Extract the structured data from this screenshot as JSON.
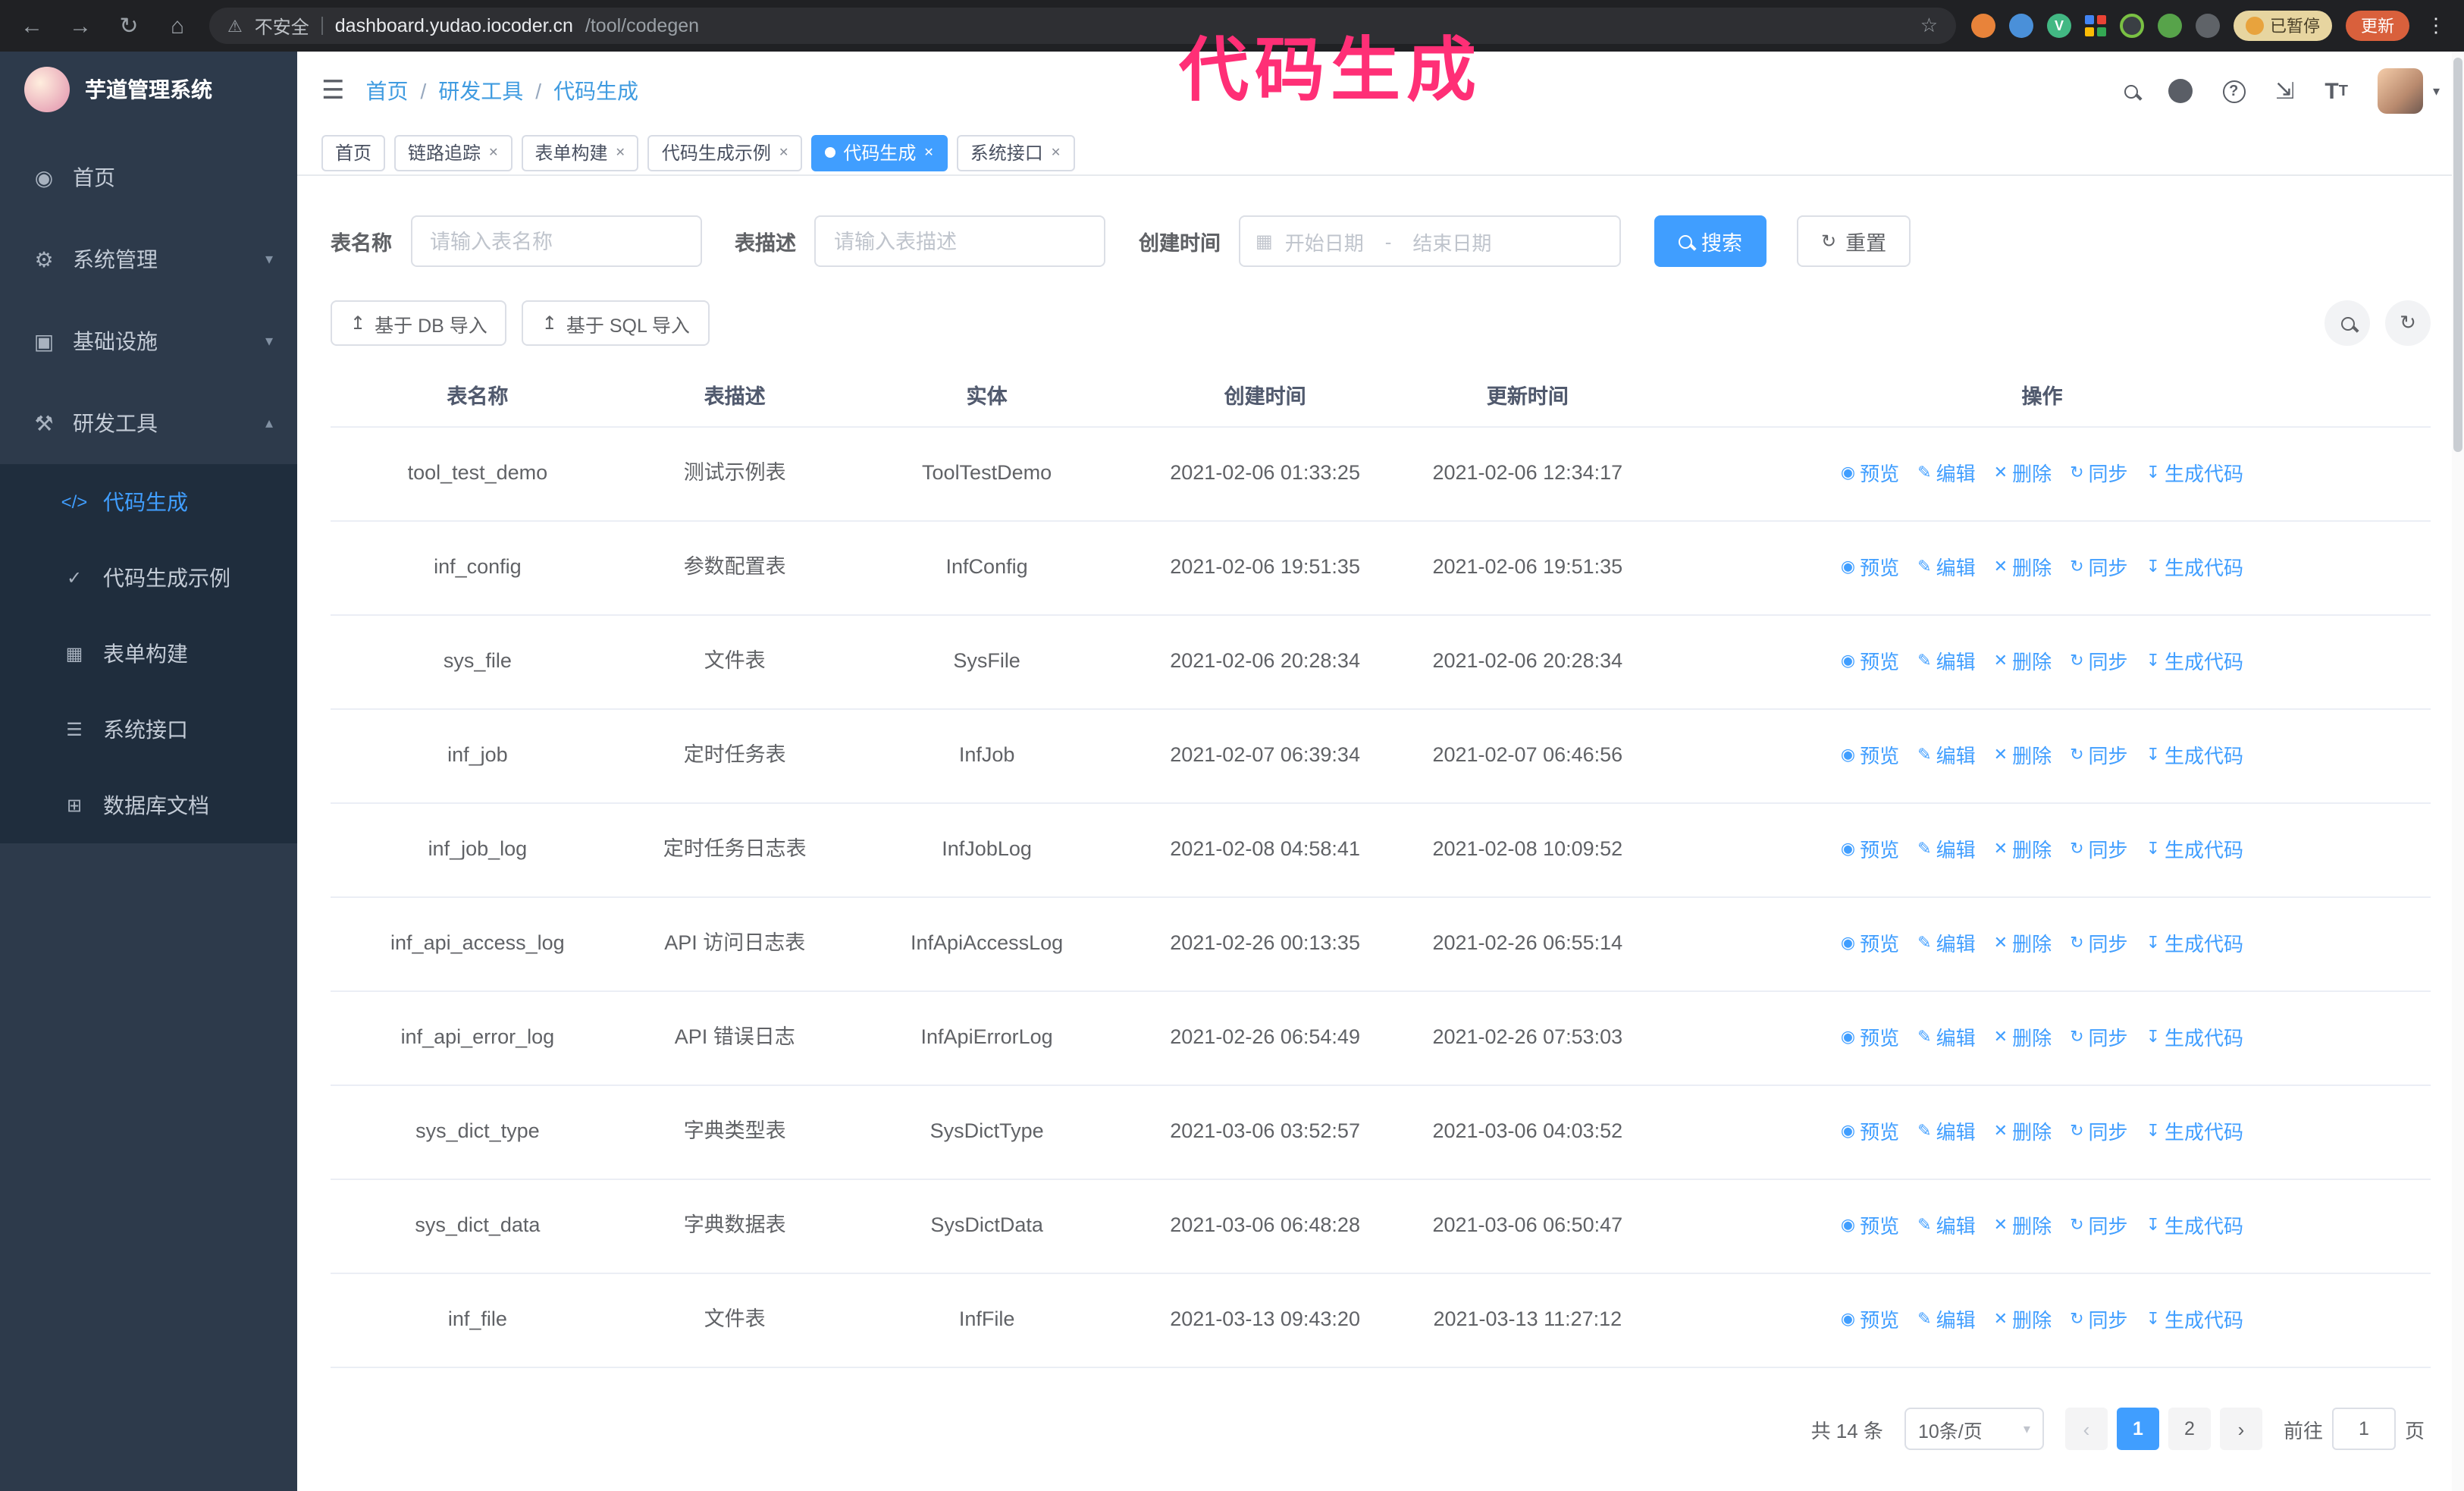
{
  "annotation": {
    "text": "代码生成",
    "color": "#ff2f76"
  },
  "browser": {
    "security_label": "不安全",
    "url_host": "dashboard.yudao.iocoder.cn",
    "url_path": "/tool/codegen",
    "paused_badge": "已暂停",
    "update_button": "更新"
  },
  "sidebar": {
    "app_title": "芋道管理系统",
    "items": [
      {
        "label": "首页"
      },
      {
        "label": "系统管理"
      },
      {
        "label": "基础设施"
      },
      {
        "label": "研发工具"
      }
    ],
    "subitems": [
      {
        "label": "代码生成",
        "active": true
      },
      {
        "label": "代码生成示例"
      },
      {
        "label": "表单构建"
      },
      {
        "label": "系统接口"
      },
      {
        "label": "数据库文档"
      }
    ]
  },
  "navbar": {
    "breadcrumb": [
      "首页",
      "研发工具",
      "代码生成"
    ]
  },
  "tabs": [
    {
      "label": "首页"
    },
    {
      "label": "链路追踪"
    },
    {
      "label": "表单构建"
    },
    {
      "label": "代码生成示例"
    },
    {
      "label": "代码生成",
      "active": true
    },
    {
      "label": "系统接口"
    }
  ],
  "filters": {
    "table_name_label": "表名称",
    "table_name_placeholder": "请输入表名称",
    "table_desc_label": "表描述",
    "table_desc_placeholder": "请输入表描述",
    "create_time_label": "创建时间",
    "date_start_placeholder": "开始日期",
    "date_separator": "-",
    "date_end_placeholder": "结束日期",
    "search_button": "搜索",
    "reset_button": "重置"
  },
  "toolbar": {
    "import_db_button": "基于 DB 导入",
    "import_sql_button": "基于 SQL 导入"
  },
  "table": {
    "columns": [
      "表名称",
      "表描述",
      "实体",
      "创建时间",
      "更新时间",
      "操作"
    ],
    "actions": [
      "预览",
      "编辑",
      "删除",
      "同步",
      "生成代码"
    ],
    "rows": [
      {
        "name": "tool_test_demo",
        "desc": "测试示例表",
        "entity": "ToolTestDemo",
        "created": "2021-02-06 01:33:25",
        "updated": "2021-02-06 12:34:17"
      },
      {
        "name": "inf_config",
        "desc": "参数配置表",
        "entity": "InfConfig",
        "created": "2021-02-06 19:51:35",
        "updated": "2021-02-06 19:51:35"
      },
      {
        "name": "sys_file",
        "desc": "文件表",
        "entity": "SysFile",
        "created": "2021-02-06 20:28:34",
        "updated": "2021-02-06 20:28:34"
      },
      {
        "name": "inf_job",
        "desc": "定时任务表",
        "entity": "InfJob",
        "created": "2021-02-07 06:39:34",
        "updated": "2021-02-07 06:46:56"
      },
      {
        "name": "inf_job_log",
        "desc": "定时任务日志表",
        "entity": "InfJobLog",
        "created": "2021-02-08 04:58:41",
        "updated": "2021-02-08 10:09:52"
      },
      {
        "name": "inf_api_access_log",
        "desc": "API 访问日志表",
        "entity": "InfApiAccessLog",
        "created": "2021-02-26 00:13:35",
        "updated": "2021-02-26 06:55:14"
      },
      {
        "name": "inf_api_error_log",
        "desc": "API 错误日志",
        "entity": "InfApiErrorLog",
        "created": "2021-02-26 06:54:49",
        "updated": "2021-02-26 07:53:03"
      },
      {
        "name": "sys_dict_type",
        "desc": "字典类型表",
        "entity": "SysDictType",
        "created": "2021-03-06 03:52:57",
        "updated": "2021-03-06 04:03:52"
      },
      {
        "name": "sys_dict_data",
        "desc": "字典数据表",
        "entity": "SysDictData",
        "created": "2021-03-06 06:48:28",
        "updated": "2021-03-06 06:50:47"
      },
      {
        "name": "inf_file",
        "desc": "文件表",
        "entity": "InfFile",
        "created": "2021-03-13 09:43:20",
        "updated": "2021-03-13 11:27:12"
      }
    ]
  },
  "pagination": {
    "total": "共 14 条",
    "page_size": "10条/页",
    "page_1": "1",
    "page_2": "2",
    "goto_label": "前往",
    "goto_value": "1",
    "goto_suffix": "页"
  },
  "icons": {
    "back": "←",
    "forward": "→",
    "reload": "↻",
    "home": "⌂",
    "warning": "⚠",
    "star": "☆",
    "kebab": "⋮",
    "hamburger": "☰",
    "help": "?",
    "fullscreen": "⇲",
    "font_size_big": "T",
    "font_size_small": "T",
    "caret_down": "▾",
    "chevron_down": "▾",
    "chevron_up": "▴",
    "menu_home": "◉",
    "menu_system": "⚙",
    "menu_infra": "▣",
    "menu_tools": "⚒",
    "sub_codegen": "</>",
    "sub_example": "✓",
    "sub_form": "▦",
    "sub_api": "☰",
    "sub_db": "⊞",
    "calendar": "▦",
    "upload": "↥",
    "refresh": "↻",
    "eye": "◉",
    "edit": "✎",
    "trash": "✕",
    "sync": "↻",
    "download": "↧",
    "prev": "‹",
    "next": "›",
    "tab_close": "✕",
    "vue": "V"
  }
}
